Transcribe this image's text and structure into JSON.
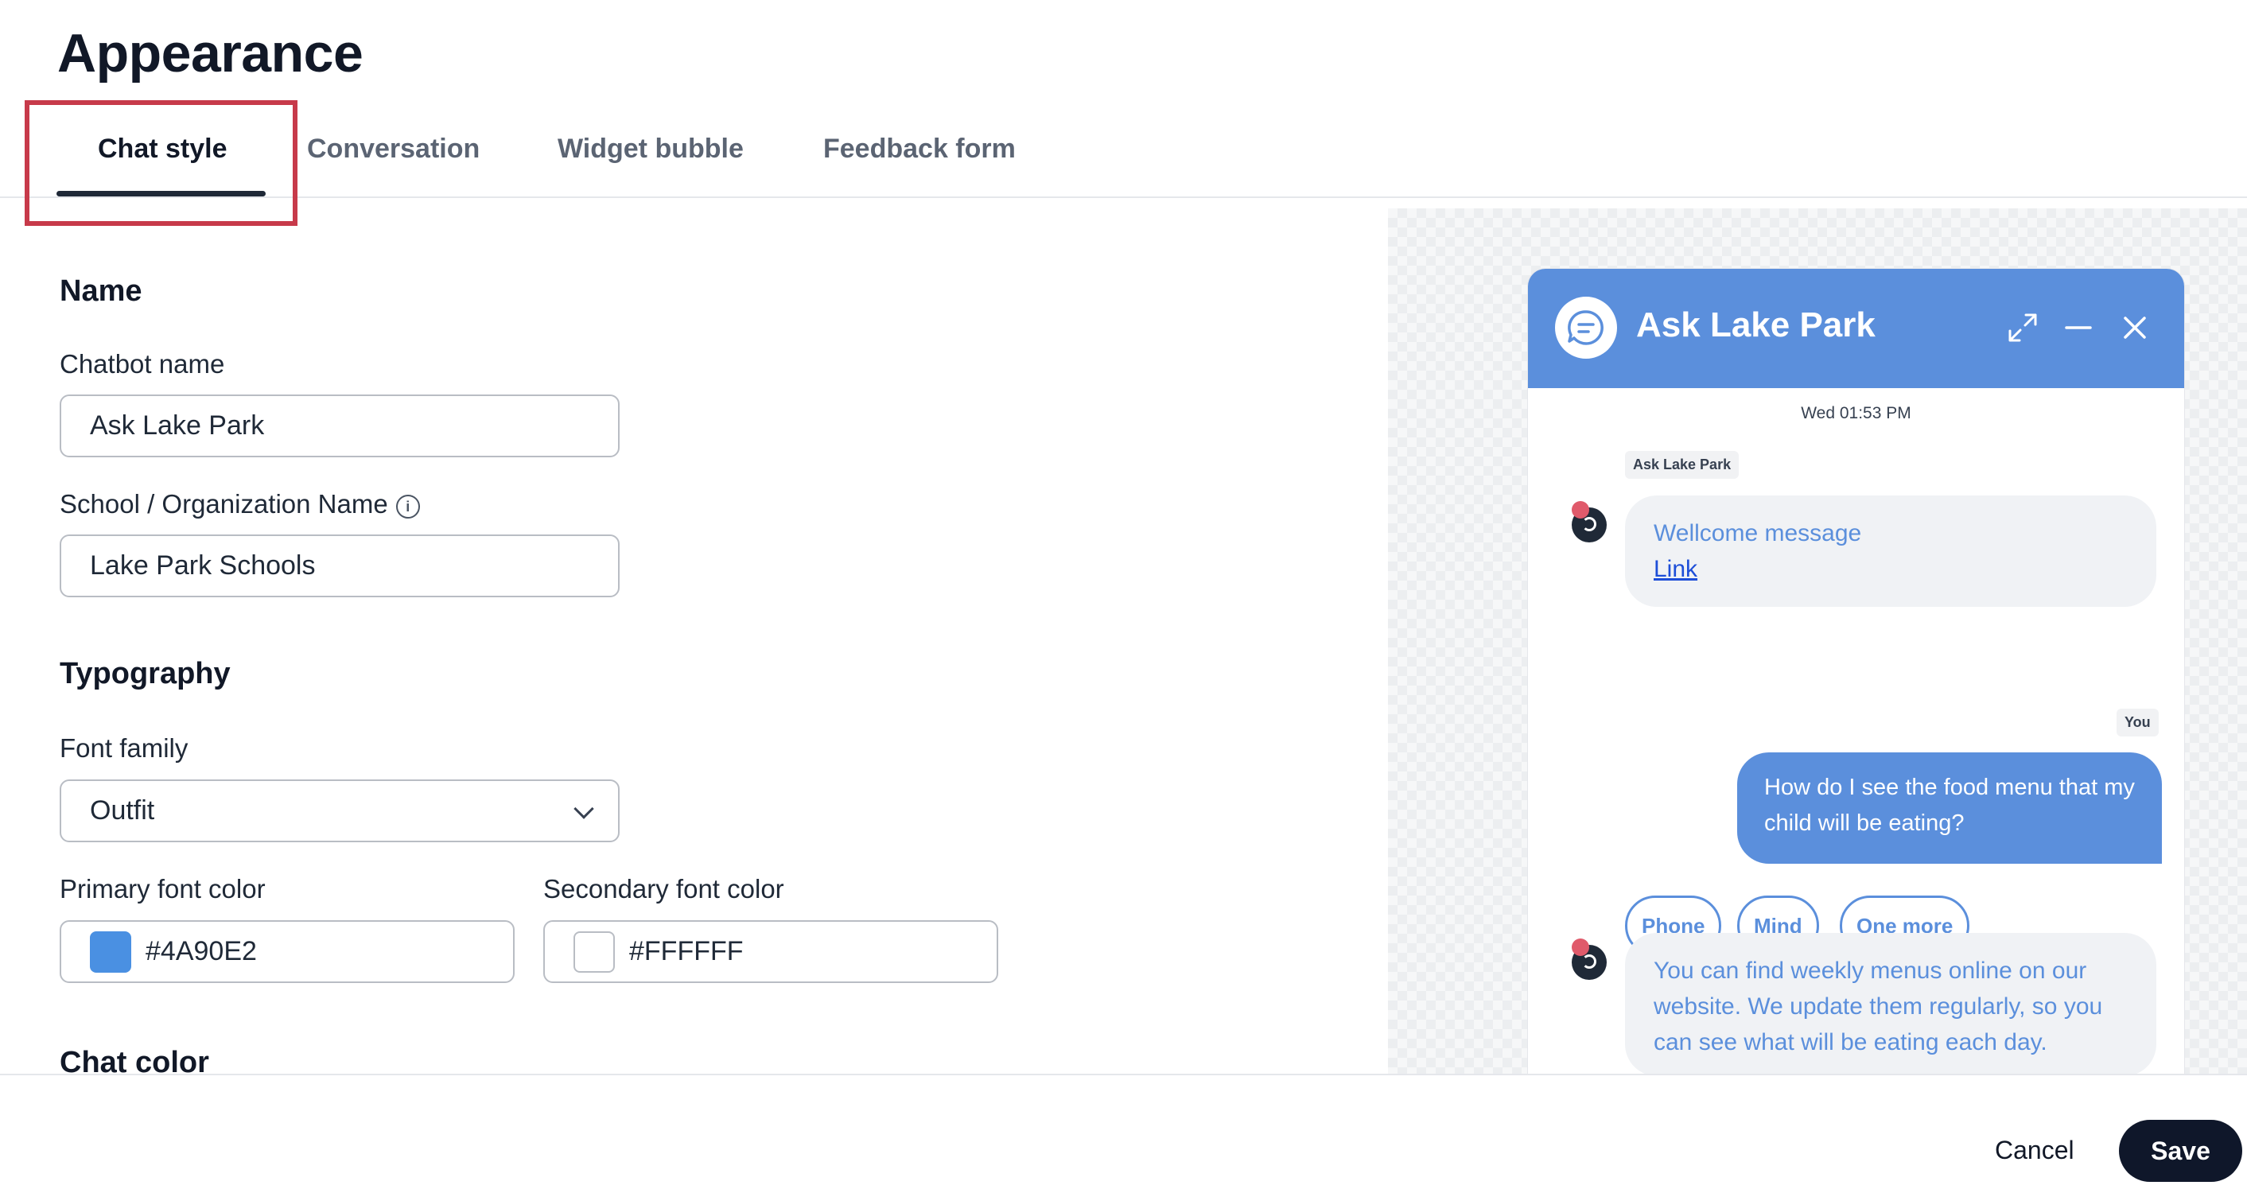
{
  "page": {
    "title": "Appearance"
  },
  "tabs": [
    {
      "label": "Chat style",
      "active": true
    },
    {
      "label": "Conversation",
      "active": false
    },
    {
      "label": "Widget bubble",
      "active": false
    },
    {
      "label": "Feedback form",
      "active": false
    }
  ],
  "name_section": {
    "title": "Name",
    "chatbot_name_label": "Chatbot name",
    "chatbot_name_value": "Ask Lake Park",
    "org_name_label": "School / Organization Name",
    "org_name_value": "Lake Park Schools"
  },
  "typography": {
    "title": "Typography",
    "font_family_label": "Font family",
    "font_family_value": "Outfit",
    "primary_color_label": "Primary font color",
    "primary_color_value": "#4A90E2",
    "secondary_color_label": "Secondary font color",
    "secondary_color_value": "#FFFFFF"
  },
  "chat_color": {
    "title": "Chat color"
  },
  "footer": {
    "cancel_label": "Cancel",
    "save_label": "Save"
  },
  "preview": {
    "title": "Ask Lake Park",
    "timestamp": "Wed 01:53 PM",
    "bot_sender": "Ask Lake Park",
    "user_sender": "You",
    "welcome_text": "Wellcome message",
    "welcome_link": "Link",
    "quick_replies": [
      "Phone",
      "Mind",
      "One more"
    ],
    "user_message": "How do I see the food menu that my child will be eating?",
    "bot_reply": "You can find weekly menus online on our website. We update them regularly, so you can see what will be eating each day."
  },
  "colors": {
    "accent": "#5B8FDC",
    "dark": "#0F172A",
    "highlight": "#C73A4A"
  },
  "icons": [
    "info-icon",
    "chevron-down-icon",
    "chat-bubble-icon",
    "expand-icon",
    "minimize-icon",
    "close-icon"
  ]
}
